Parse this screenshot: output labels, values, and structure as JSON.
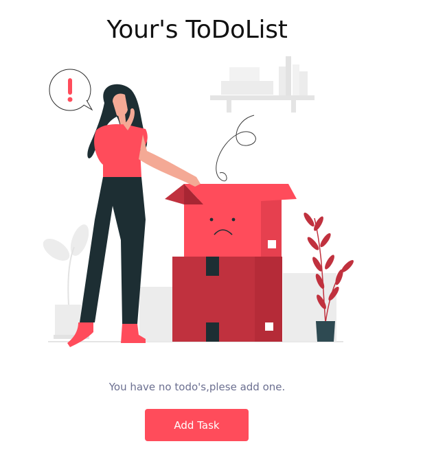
{
  "app": {
    "title": "Your's ToDoList"
  },
  "empty_state": {
    "message": "You have no todo's,plese add one.",
    "illustration_icon": "confused-woman-empty-box-illustration",
    "alert_icon": "exclamation-icon"
  },
  "actions": {
    "add_task_label": "Add Task"
  },
  "colors": {
    "accent": "#ff4c5b",
    "box_dark": "#c0313e",
    "dark": "#1d2e33",
    "muted_text": "#6b6f90",
    "light_gray": "#ebebeb"
  }
}
